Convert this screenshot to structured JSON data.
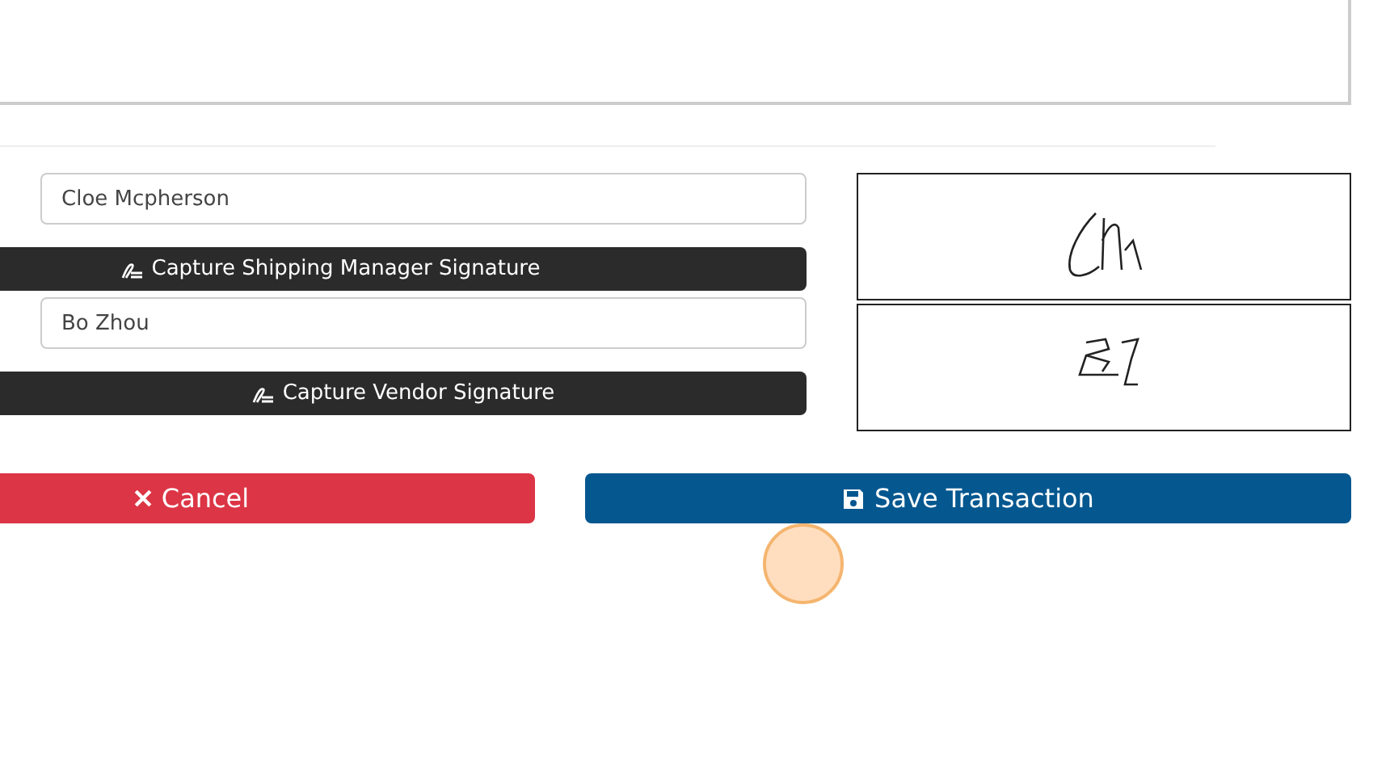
{
  "signers": [
    {
      "name": "Cloe Mcpherson",
      "button": "Capture Shipping Manager Signature"
    },
    {
      "name": "Bo Zhou",
      "button": "Capture Vendor Signature"
    }
  ],
  "actions": [
    {
      "kind": "cancel",
      "label": "Cancel"
    },
    {
      "kind": "save",
      "label": "Save Transaction"
    }
  ]
}
